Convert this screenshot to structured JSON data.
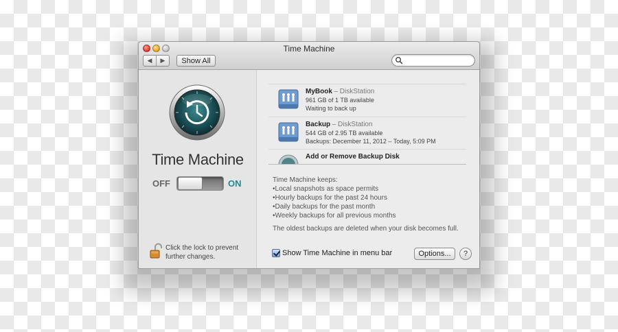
{
  "window": {
    "title": "Time Machine",
    "show_all_label": "Show All",
    "back_glyph": "◀",
    "forward_glyph": "▶",
    "search_placeholder": ""
  },
  "left": {
    "app_title": "Time Machine",
    "toggle": {
      "off_label": "OFF",
      "on_label": "ON",
      "state": "off"
    },
    "lock_text": "Click the lock to prevent further changes.",
    "icon": "time-machine-icon"
  },
  "disks": [
    {
      "name": "MyBook",
      "server": "– DiskStation",
      "line1": "961 GB of 1 TB available",
      "line2": "Waiting to back up"
    },
    {
      "name": "Backup",
      "server": "– DiskStation",
      "line1": "544 GB of 2.95 TB available",
      "line2": "Backups: December 11, 2012 – Today, 5:09 PM"
    },
    {
      "name": "Add or Remove Backup Disk",
      "server": "",
      "line1": "",
      "line2": ""
    }
  ],
  "info": {
    "heading": "Time Machine keeps:",
    "items": [
      "Local snapshots as space permits",
      "Hourly backups for the past 24 hours",
      "Daily backups for the past month",
      "Weekly backups for all previous months"
    ],
    "footer": "The oldest backups are deleted when your disk becomes full."
  },
  "bottom": {
    "show_in_menu_bar_label": "Show Time Machine in menu bar",
    "show_in_menu_bar_checked": true,
    "options_label": "Options...",
    "help_label": "?"
  },
  "colors": {
    "on_accent": "#1e8b94",
    "checkbox_blue": "#7aa6e3"
  }
}
